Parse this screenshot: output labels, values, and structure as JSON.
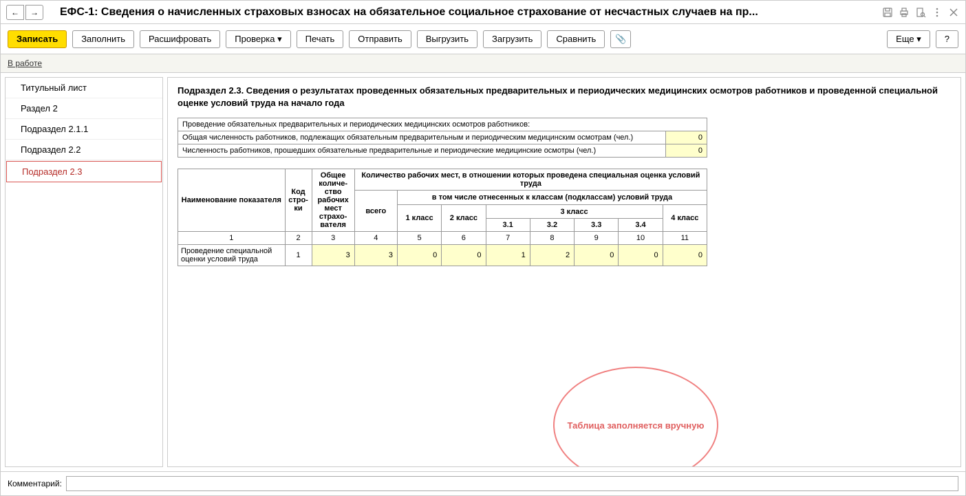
{
  "title": "ЕФС-1: Сведения о начисленных страховых взносах на обязательное социальное страхование от несчастных случаев на пр...",
  "toolbar": {
    "save": "Записать",
    "fill": "Заполнить",
    "decode": "Расшифровать",
    "check": "Проверка",
    "print": "Печать",
    "send": "Отправить",
    "export": "Выгрузить",
    "import": "Загрузить",
    "compare": "Сравнить",
    "more": "Еще",
    "help": "?"
  },
  "status": "В работе",
  "sidebar": {
    "items": [
      "Титульный лист",
      "Раздел 2",
      "Подраздел 2.1.1",
      "Подраздел 2.2",
      "Подраздел 2.3"
    ]
  },
  "section_title": "Подраздел 2.3. Сведения о результатах проведенных обязательных предварительных и периодических медицинских осмотров работников и проведенной специальной оценке условий труда на начало года",
  "mini": {
    "header": "Проведение обязательных предварительных и периодических медицинских осмотров работников:",
    "row1_label": "Общая численность работников, подлежащих обязательным предварительным и периодическим медицинским осмотрам (чел.)",
    "row1_val": "0",
    "row2_label": "Численность работников, прошедших обязательные предварительные и периодические медицинские осмотры (чел.)",
    "row2_val": "0"
  },
  "table": {
    "h_name": "Наименование показателя",
    "h_code": "Код стро­ки",
    "h_total": "Общее количе­ство рабочих мест страхо­вателя",
    "h_places": "Количество рабочих мест, в отношении которых проведена специальная оценка условий труда",
    "h_all": "всего",
    "h_classes": "в том числе отнесенных к классам (подклассам) условий труда",
    "h_c1": "1 класс",
    "h_c2": "2 класс",
    "h_c3": "3 класс",
    "h_c31": "3.1",
    "h_c32": "3.2",
    "h_c33": "3.3",
    "h_c34": "3.4",
    "h_c4": "4 класс",
    "cols": [
      "1",
      "2",
      "3",
      "4",
      "5",
      "6",
      "7",
      "8",
      "9",
      "10",
      "11"
    ],
    "row_label": "Проведение специальной оценки условий труда",
    "row": [
      "1",
      "3",
      "3",
      "0",
      "0",
      "1",
      "2",
      "0",
      "0",
      "0"
    ]
  },
  "annotation": "Таблица заполняется вручную",
  "footer_label": "Комментарий:"
}
